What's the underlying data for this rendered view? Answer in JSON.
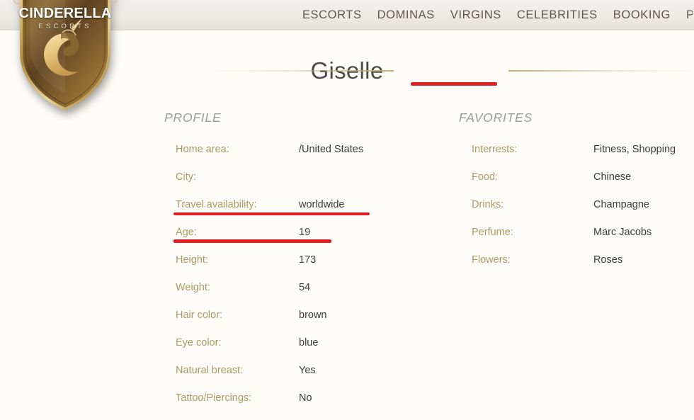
{
  "site": {
    "logo_name": "CINDERELLA",
    "logo_tagline": "ESCORTS"
  },
  "nav": {
    "items": [
      {
        "label": "ESCORTS"
      },
      {
        "label": "DOMINAS"
      },
      {
        "label": "VIRGINS"
      },
      {
        "label": "CELEBRITIES"
      },
      {
        "label": "BOOKING"
      },
      {
        "label": "P"
      }
    ]
  },
  "page": {
    "title": "Giselle"
  },
  "profile": {
    "heading": "PROFILE",
    "rows": [
      {
        "label": "Home area:",
        "value": "/United States"
      },
      {
        "label": "City:",
        "value": ""
      },
      {
        "label": "Travel availability:",
        "value": "worldwide"
      },
      {
        "label": "Age:",
        "value": "19"
      },
      {
        "label": "Height:",
        "value": "173"
      },
      {
        "label": "Weight:",
        "value": "54"
      },
      {
        "label": "Hair color:",
        "value": "brown"
      },
      {
        "label": "Eye color:",
        "value": "blue"
      },
      {
        "label": "Natural breast:",
        "value": "Yes"
      },
      {
        "label": "Tattoo/Piercings:",
        "value": "No"
      }
    ]
  },
  "favorites": {
    "heading": "FAVORITES",
    "rows": [
      {
        "label": "Interrests:",
        "value": "Fitness, Shopping"
      },
      {
        "label": "Food:",
        "value": "Chinese"
      },
      {
        "label": "Drinks:",
        "value": "Champagne"
      },
      {
        "label": "Perfume:",
        "value": "Marc Jacobs"
      },
      {
        "label": "Flowers:",
        "value": "Roses"
      }
    ]
  },
  "colors": {
    "gold_rule": "#c6ac6b",
    "label_gold": "#ab9a63",
    "value_text": "#3b3b3b",
    "heading_grey": "#9b9b9b",
    "annotation_red": "#e02020",
    "header_bar": "#edeae6",
    "page_background": "#fdfcf8"
  }
}
